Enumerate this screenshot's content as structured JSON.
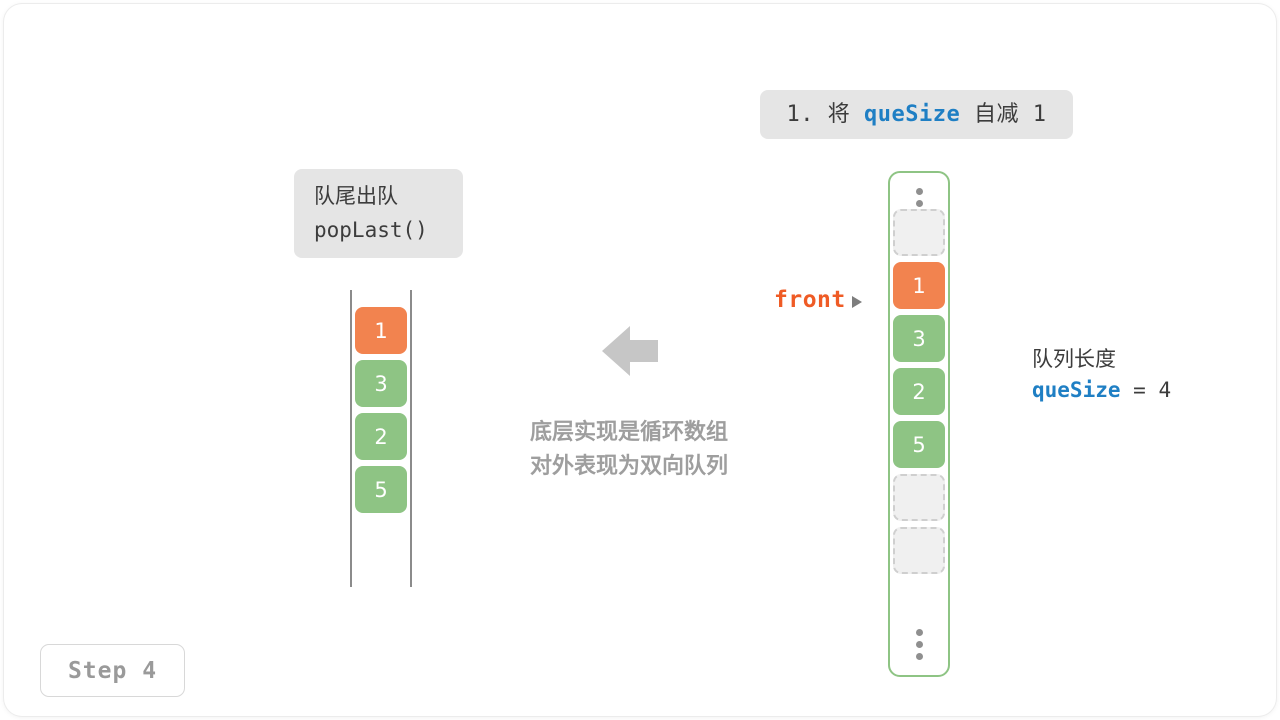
{
  "title_box": {
    "prefix": "1. 将 ",
    "keyword": "queSize",
    "suffix": " 自减 1"
  },
  "op_box": {
    "line1": "队尾出队",
    "line2": "popLast()"
  },
  "step_badge": {
    "label": "Step 4"
  },
  "front_pointer": {
    "label": "front",
    "arrow_glyph": "➤"
  },
  "size_note": {
    "line1": "队列长度",
    "keyword": "queSize",
    "equals": " = 4"
  },
  "center_caption": {
    "line1": "底层实现是循环数组",
    "line2": "对外表现为双向队列"
  },
  "left_column": {
    "cells": [
      {
        "value": "1",
        "kind": "orange"
      },
      {
        "value": "3",
        "kind": "green"
      },
      {
        "value": "2",
        "kind": "green"
      },
      {
        "value": "5",
        "kind": "green"
      }
    ]
  },
  "right_column": {
    "top_dots": "⋮",
    "bottom_dots": "⋮",
    "cells": [
      {
        "value": "",
        "kind": "empty"
      },
      {
        "value": "1",
        "kind": "orange"
      },
      {
        "value": "3",
        "kind": "green"
      },
      {
        "value": "2",
        "kind": "green"
      },
      {
        "value": "5",
        "kind": "green"
      },
      {
        "value": "",
        "kind": "empty"
      },
      {
        "value": "",
        "kind": "empty"
      }
    ]
  },
  "colors": {
    "orange": "#f2834f",
    "green": "#8ec484",
    "blue": "#1f7fc4",
    "front_orange": "#ef5b25",
    "gray_text": "#9e9e9e",
    "box_gray": "#e5e5e5",
    "empty_fill": "#f0f0f0",
    "empty_border": "#cfcfcf"
  }
}
